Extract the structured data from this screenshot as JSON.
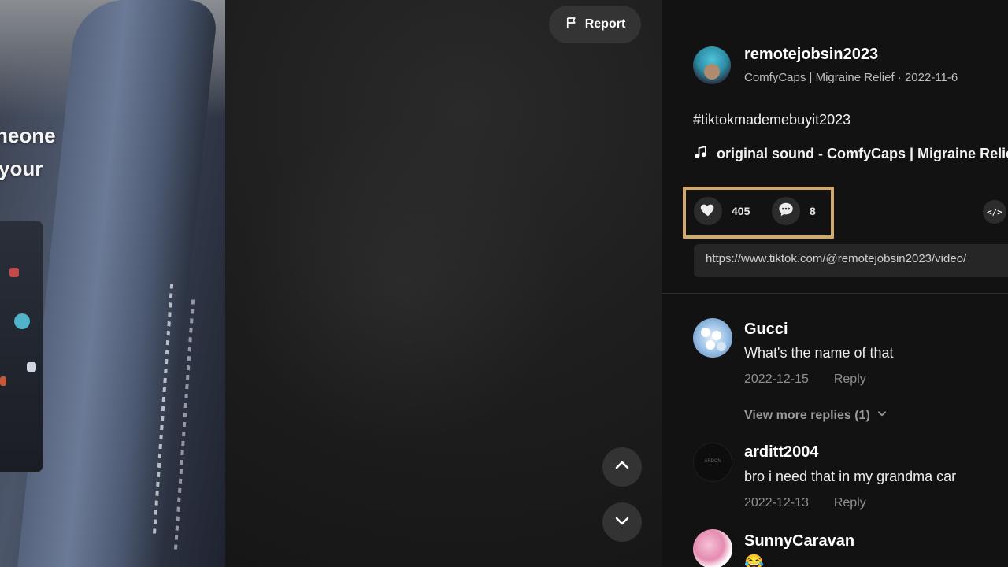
{
  "video": {
    "caption_line1": "neone",
    "caption_line2": "your",
    "report_label": "Report"
  },
  "post": {
    "author_username": "remotejobsin2023",
    "author_meta": "ComfyCaps | Migraine Relief · 2022-11-6",
    "hashtag": "#tiktokmademebuyit2023",
    "sound": "original sound - ComfyCaps | Migraine Relief",
    "likes": "405",
    "comments": "8",
    "embed_label": "</>",
    "link": "https://www.tiktok.com/@remotejobsin2023/video/"
  },
  "comments": [
    {
      "username": "Gucci",
      "text": "What's the name of that",
      "date": "2022-12-15",
      "reply_label": "Reply",
      "more_replies": "View more replies (1)"
    },
    {
      "username": "arditt2004",
      "text": "bro i need that in my grandma car",
      "date": "2022-12-13",
      "reply_label": "Reply"
    },
    {
      "username": "SunnyCaravan",
      "text": "😂"
    }
  ],
  "colors": {
    "highlight": "#d2a86b",
    "panel_bg": "#121212"
  },
  "icons": [
    "flag-icon",
    "chevron-up-icon",
    "chevron-down-icon",
    "music-note-icon",
    "heart-icon",
    "comment-icon",
    "embed-icon"
  ]
}
